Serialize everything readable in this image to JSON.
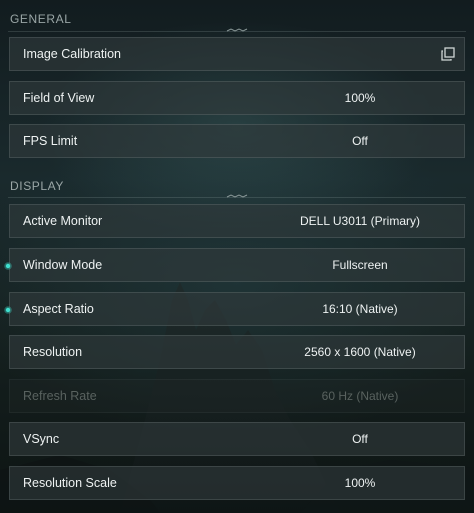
{
  "sections": {
    "general": {
      "title": "GENERAL",
      "rows": [
        {
          "label": "Image Calibration",
          "value": "",
          "icon": "external-window-icon"
        },
        {
          "label": "Field of View",
          "value": "100%"
        },
        {
          "label": "FPS Limit",
          "value": "Off"
        }
      ]
    },
    "display": {
      "title": "DISPLAY",
      "rows": [
        {
          "label": "Active Monitor",
          "value": "DELL U3011 (Primary)"
        },
        {
          "label": "Window Mode",
          "value": "Fullscreen",
          "changed": true
        },
        {
          "label": "Aspect Ratio",
          "value": "16:10 (Native)",
          "changed": true
        },
        {
          "label": "Resolution",
          "value": "2560 x 1600 (Native)"
        },
        {
          "label": "Refresh Rate",
          "value": "60 Hz (Native)",
          "disabled": true
        },
        {
          "label": "VSync",
          "value": "Off"
        },
        {
          "label": "Resolution Scale",
          "value": "100%"
        }
      ]
    }
  },
  "colors": {
    "accent_dot": "#3fe0cf",
    "row_bg": "#303a3c",
    "section_title": "#9aa6a6"
  }
}
